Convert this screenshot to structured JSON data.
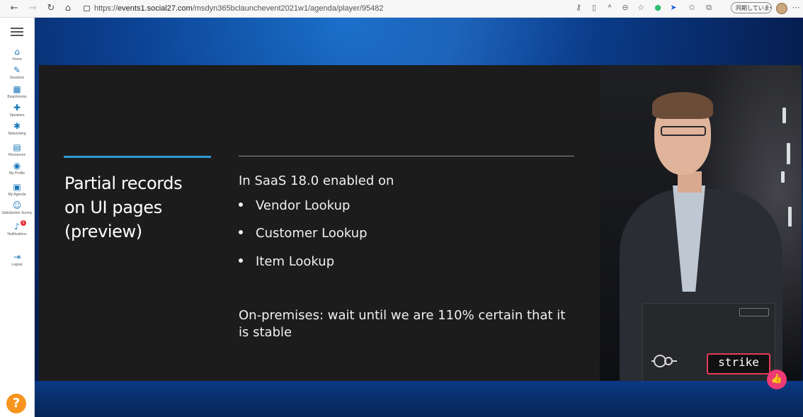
{
  "browser": {
    "url_prefix": "https://",
    "url_host": "events1.social27.com",
    "url_path": "/msdyn365bclaunchevent2021w1/agenda/player/95482",
    "sync_status": "同期していません",
    "icons": {
      "back": "back-arrow-icon",
      "forward": "forward-arrow-icon",
      "reload": "reload-icon",
      "home": "home-icon",
      "lock": "lock-icon",
      "more": "more-icon"
    }
  },
  "sidebar": {
    "items": [
      {
        "label": "Home",
        "icon": "home-icon",
        "glyph": "⌂"
      },
      {
        "label": "Sessions",
        "icon": "pencil-icon",
        "glyph": "✎"
      },
      {
        "label": "Boardrooms",
        "icon": "boardroom-icon",
        "glyph": "▦"
      },
      {
        "label": "Speakers",
        "icon": "speaker-icon",
        "glyph": "✚"
      },
      {
        "label": "Networking",
        "icon": "networking-icon",
        "glyph": "✱"
      },
      {
        "label": "Resources",
        "icon": "resources-icon",
        "glyph": "▤"
      },
      {
        "label": "My Profile",
        "icon": "profile-icon",
        "glyph": "◉"
      },
      {
        "label": "My Agenda",
        "icon": "calendar-icon",
        "glyph": "▣"
      },
      {
        "label": "Satisfaction Survey",
        "icon": "survey-icon",
        "glyph": "☺"
      },
      {
        "label": "Notifications",
        "icon": "bell-icon",
        "glyph": "♪",
        "badge": "1"
      },
      {
        "label": "Logout",
        "icon": "logout-icon",
        "glyph": "⇥"
      }
    ],
    "help_glyph": "?"
  },
  "slide": {
    "title": "Partial records\non UI pages\n(preview)",
    "intro": "In SaaS 18.0 enabled on",
    "bullets": [
      "Vendor Lookup",
      "Customer Lookup",
      "Item Lookup"
    ],
    "note": "On-premises: wait until we are 110% certain that it is stable"
  },
  "video": {
    "laptop_sticker": "strike"
  },
  "like_glyph": "👍",
  "colors": {
    "accent_rule": "#2e9bd6",
    "slide_bg": "#1c1c1c",
    "help_button": "#f7941d",
    "like_button": "#ee3a74",
    "sidebar_icon": "#1877b8"
  }
}
